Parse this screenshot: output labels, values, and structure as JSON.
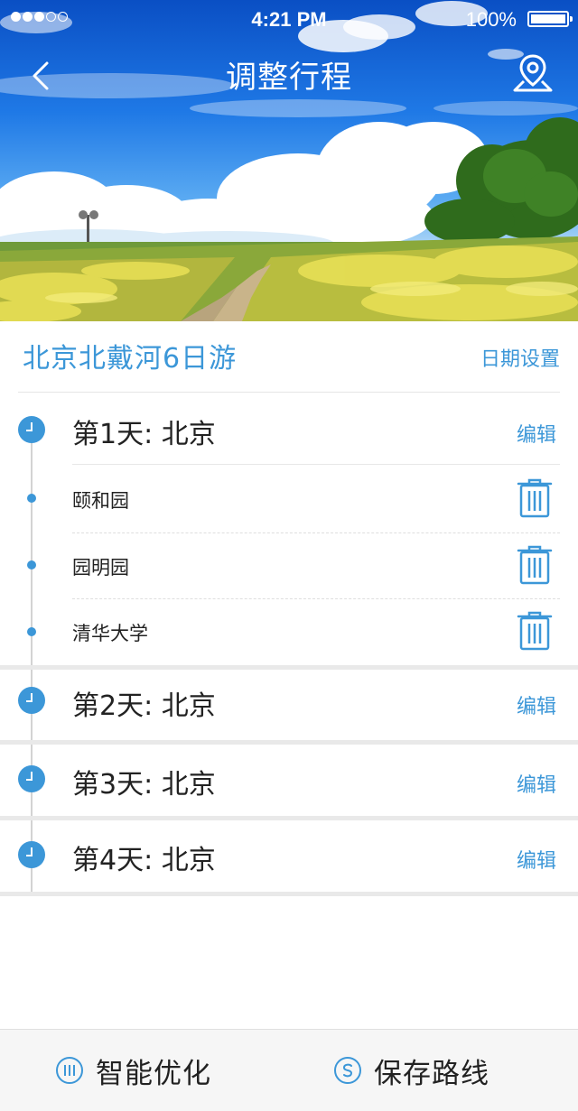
{
  "status_bar": {
    "time": "4:21 PM",
    "battery": "100%",
    "signal_icon": "signal-dots-icon",
    "battery_icon": "battery-icon"
  },
  "nav": {
    "title": "调整行程",
    "back_icon": "chevron-left-icon",
    "map_icon": "map-pin-icon"
  },
  "trip": {
    "title": "北京北戴河6日游",
    "date_settings_label": "日期设置"
  },
  "days": [
    {
      "label": "第1天: 北京",
      "edit_label": "编辑",
      "places": [
        "颐和园",
        "园明园",
        "清华大学"
      ]
    },
    {
      "label": "第2天: 北京",
      "edit_label": "编辑",
      "places": []
    },
    {
      "label": "第3天: 北京",
      "edit_label": "编辑",
      "places": []
    },
    {
      "label": "第4天: 北京",
      "edit_label": "编辑",
      "places": []
    }
  ],
  "bottom_bar": {
    "optimize_label": "智能优化",
    "optimize_icon": "optimize-icon",
    "save_label": "保存路线",
    "save_icon": "save-s-icon"
  },
  "colors": {
    "accent": "#3c97d8",
    "text": "#222222",
    "divider": "#e9e9e9"
  }
}
